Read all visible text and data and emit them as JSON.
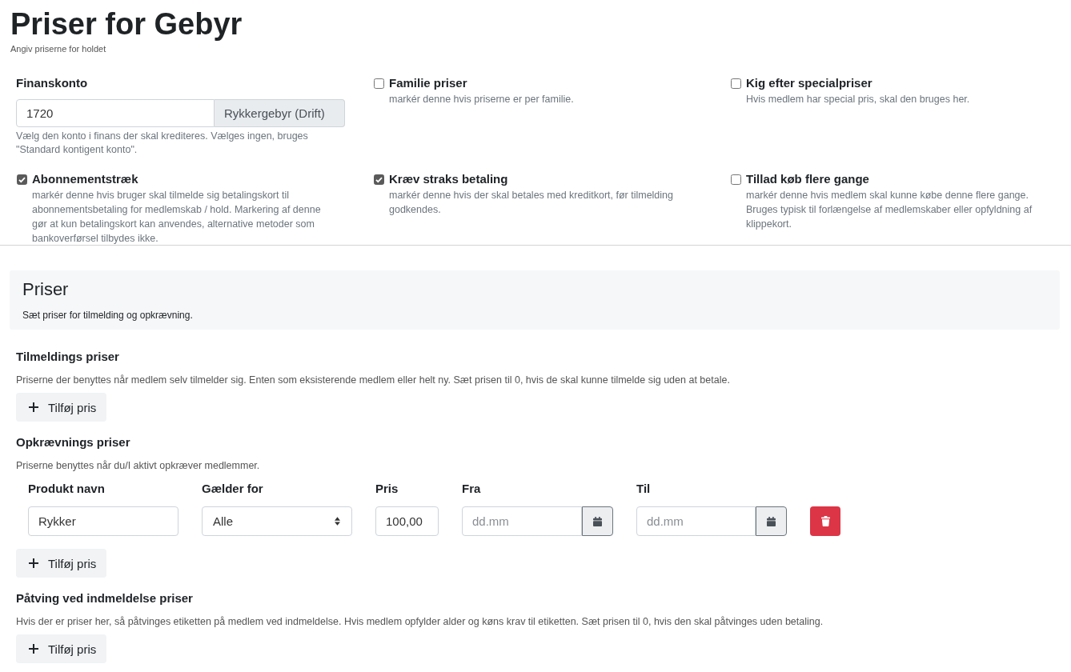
{
  "page": {
    "title": "Priser for Gebyr",
    "subtitle": "Angiv priserne for holdet"
  },
  "settings": [
    {
      "kind": "account",
      "label": "Finanskonto",
      "value": "1720",
      "addon": "Rykkergebyr (Drift)",
      "help": "Vælg den konto i finans der skal krediteres. Vælges ingen, bruges \"Standard kontigent konto\"."
    },
    {
      "kind": "checkbox",
      "label": "Familie priser",
      "checked": false,
      "help": "markér denne hvis priserne er per familie."
    },
    {
      "kind": "checkbox",
      "label": "Kig efter specialpriser",
      "checked": false,
      "help": "Hvis medlem har special pris, skal den bruges her."
    },
    {
      "kind": "checkbox",
      "label": "Abonnementstræk",
      "checked": true,
      "help": "markér denne hvis bruger skal tilmelde sig betalingskort til abonnementsbetaling for medlemskab / hold. Markering af denne gør at kun betalingskort kan anvendes, alternative metoder som bankoverførsel tilbydes ikke."
    },
    {
      "kind": "checkbox",
      "label": "Kræv straks betaling",
      "checked": true,
      "help": "markér denne hvis der skal betales med kreditkort, før tilmelding godkendes."
    },
    {
      "kind": "checkbox",
      "label": "Tillad køb flere gange",
      "checked": false,
      "help": "markér denne hvis medlem skal kunne købe denne flere gange. Bruges typisk til forlængelse af medlemskaber eller opfyldning af klippekort."
    }
  ],
  "prices_panel": {
    "title": "Priser",
    "subtitle": "Sæt priser for tilmelding og opkrævning."
  },
  "price_groups": [
    {
      "title": "Tilmeldings priser",
      "description": "Priserne der benyttes når medlem selv tilmelder sig. Enten som eksisterende medlem eller helt ny. Sæt prisen til 0, hvis de skal kunne tilmelde sig uden at betale.",
      "add_button": "Tilføj pris"
    },
    {
      "title": "Opkrævnings priser",
      "description": "Priserne benyttes når du/I aktivt opkræver medlemmer.",
      "table": {
        "columns": [
          "Produkt navn",
          "Gælder for",
          "Pris",
          "Fra",
          "Til"
        ],
        "rows": [
          {
            "product": "Rykker",
            "applies_to": "Alle",
            "price": "100,00",
            "from": {
              "placeholder": "dd.mm"
            },
            "to": {
              "placeholder": "dd.mm"
            }
          }
        ]
      },
      "add_button": "Tilføj pris"
    },
    {
      "title": "Påtving ved indmeldelse priser",
      "description": "Hvis der er priser her, så påtvinges etiketten på medlem ved indmeldelse. Hvis medlem opfylder alder og køns krav til etiketten. Sæt prisen til 0, hvis den skal påtvinges uden betaling.",
      "add_button": "Tilføj pris"
    }
  ]
}
